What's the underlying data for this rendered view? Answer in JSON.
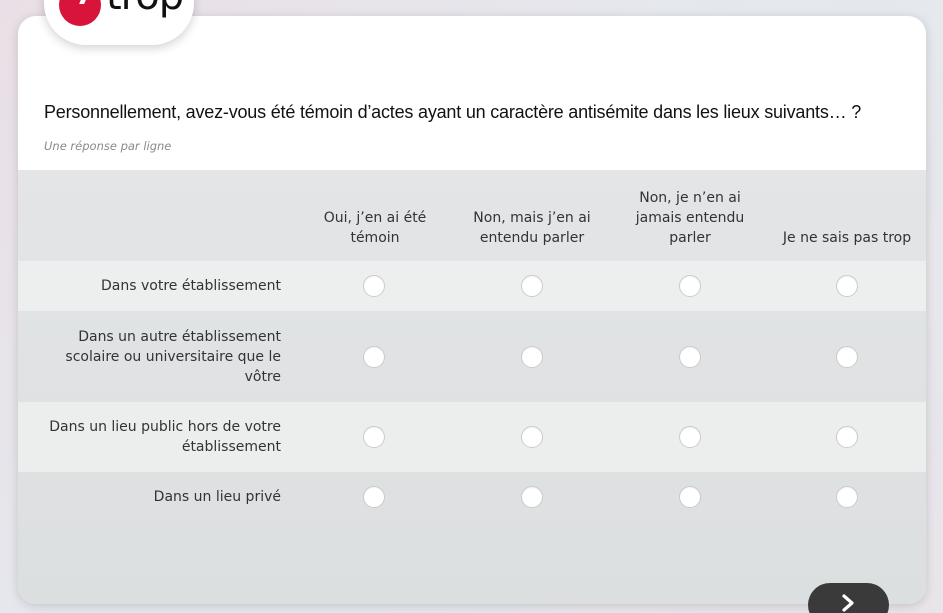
{
  "logo": {
    "text": "trop",
    "accent": "#d8143a"
  },
  "question": {
    "title": "Personnellement, avez-vous été témoin d’actes ayant un caractère antisémite dans les lieux suivants… ?",
    "hint": "Une réponse par ligne"
  },
  "columns": [
    "Oui, j’en ai été témoin",
    "Non, mais j’en ai entendu parler",
    "Non, je n’en ai jamais entendu parler",
    "Je ne sais pas trop"
  ],
  "rows": [
    "Dans votre établissement",
    "Dans un autre établissement scolaire ou universitaire que le vôtre",
    "Dans un lieu public hors de votre établissement",
    "Dans un lieu privé"
  ],
  "selected": [
    null,
    null,
    null,
    null
  ],
  "next_button": {
    "icon": "chevron-right-icon",
    "color": "#3a3a3a"
  }
}
